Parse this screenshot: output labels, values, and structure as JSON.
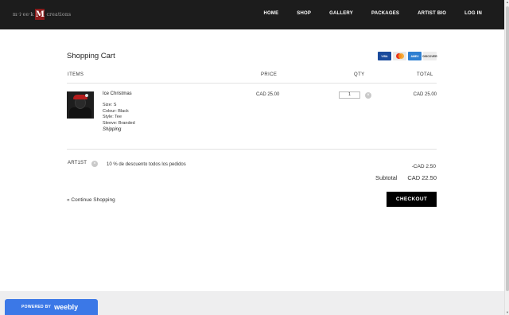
{
  "header": {
    "logo_left": "m·i·ee·k",
    "logo_mark": "M",
    "logo_right": "creations",
    "nav": [
      "HOME",
      "SHOP",
      "GALLERY",
      "PACKAGES",
      "ARTIST BIO",
      "LOG IN"
    ]
  },
  "cart": {
    "title": "Shopping Cart",
    "payment_cards": [
      "VISA",
      "MasterCard",
      "AMEX",
      "DISCOVER"
    ],
    "columns": {
      "items": "ITEMS",
      "price": "PRICE",
      "qty": "QTY",
      "total": "TOTAL"
    },
    "item": {
      "name": "Ice Christmas",
      "props": [
        "Size: S",
        "Colour: Black",
        "Style: Tee",
        "Sleeve: Branded"
      ],
      "shipping_label": "Shipping",
      "price": "CAD 25.00",
      "qty": "1",
      "total": "CAD 25.00",
      "remove_icon": "×"
    },
    "coupon": {
      "code": "ART1ST",
      "remove_icon": "×",
      "description": "10 % de descuento todos los pedidos",
      "discount": "-CAD 2.50"
    },
    "subtotal_label": "Subtotal",
    "subtotal_value": "CAD 22.50",
    "continue_label": "« Continue Shopping",
    "checkout_label": "CHECKOUT"
  },
  "footer": {
    "powered_by": "POWERED BY",
    "brand": "weebly"
  },
  "colors": {
    "header_bg": "#1c1c1c",
    "checkout_bg": "#000000",
    "weebly_blue": "#3b78e7"
  }
}
